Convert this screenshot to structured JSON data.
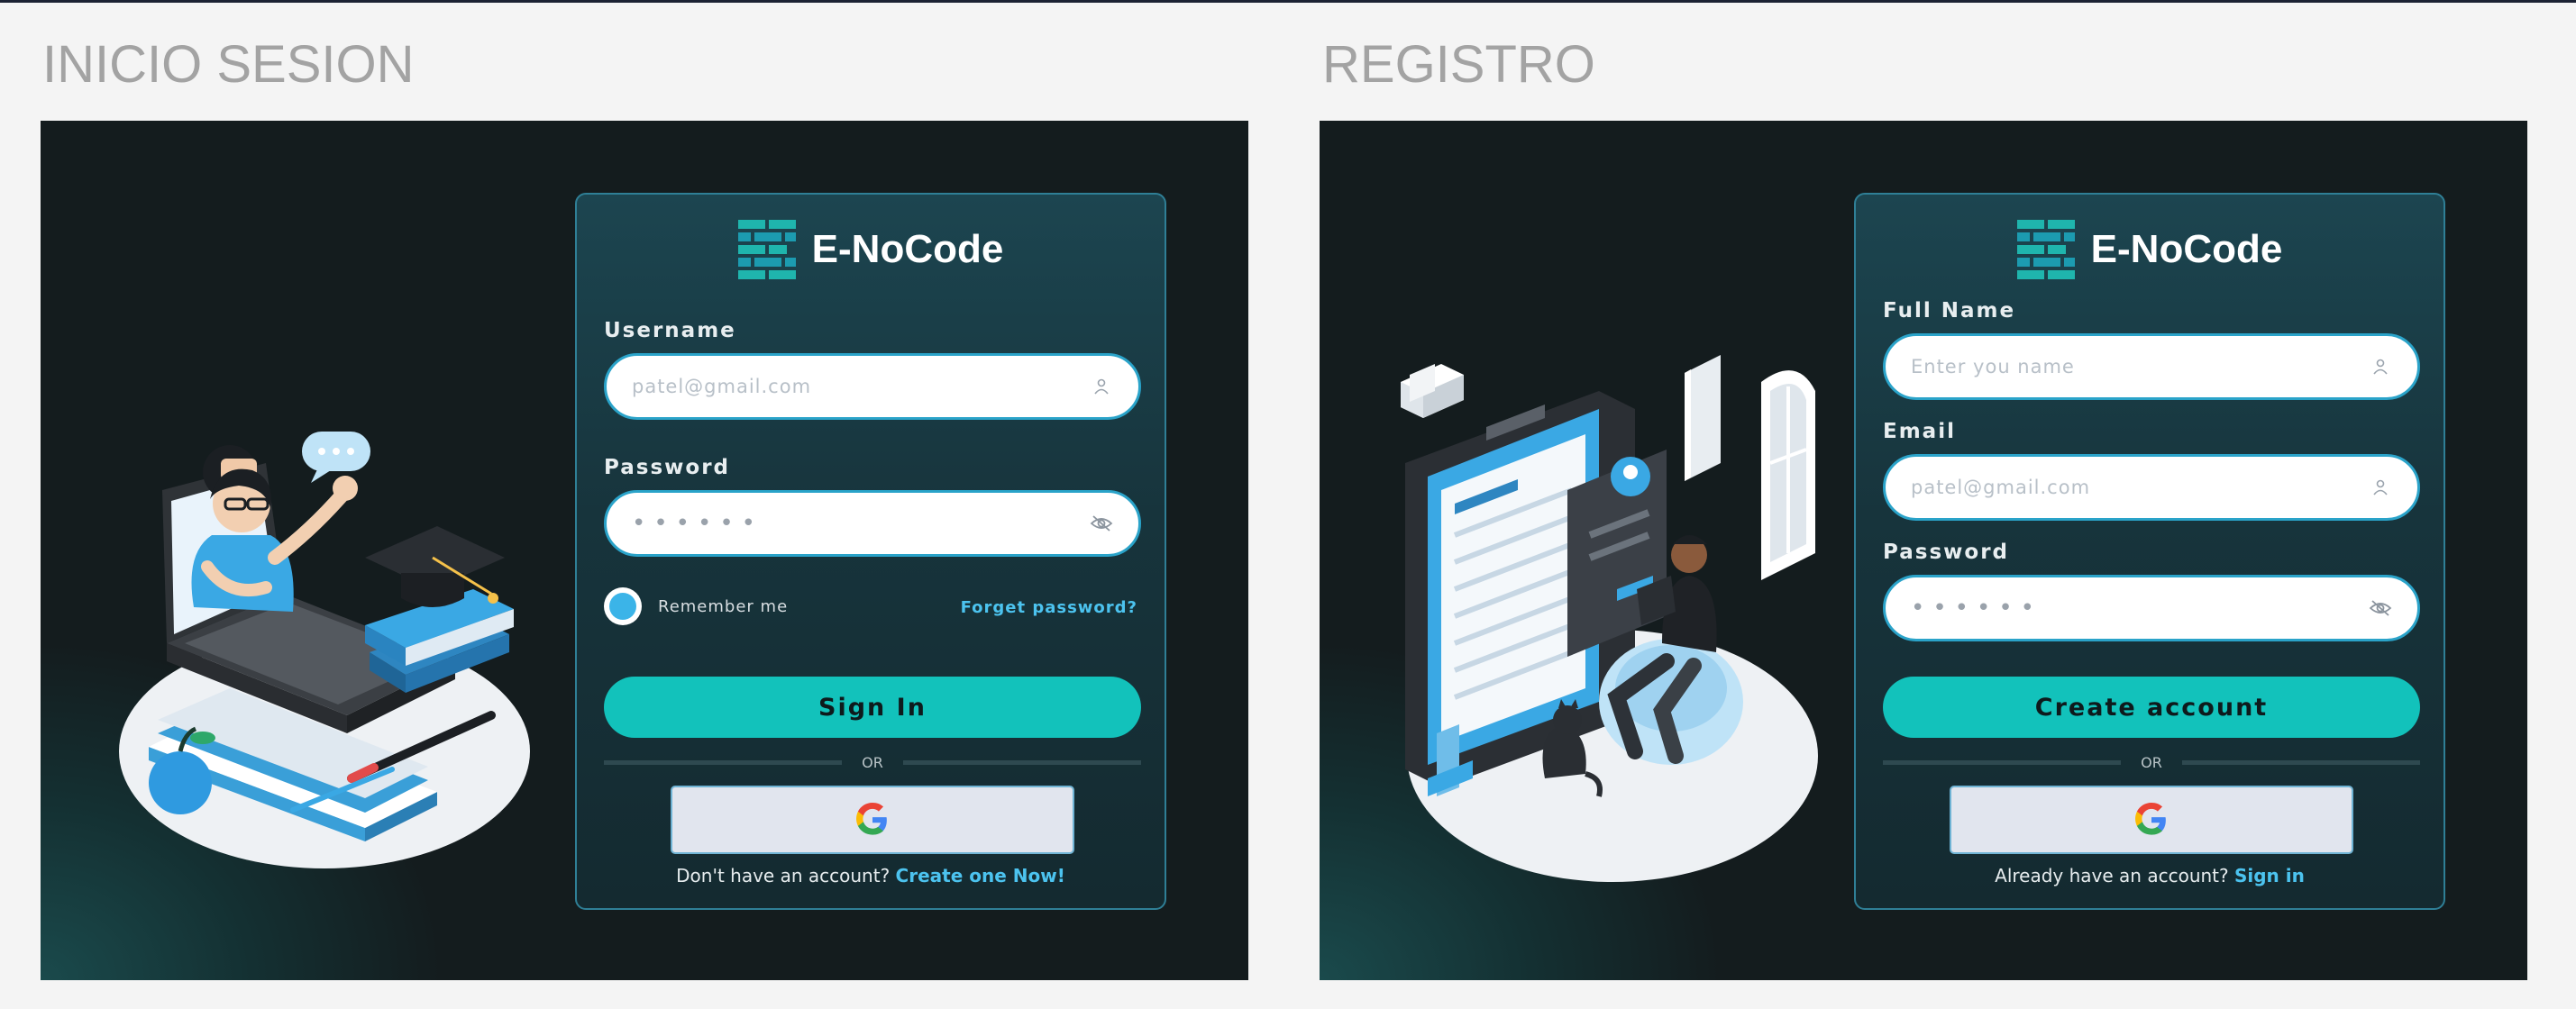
{
  "login": {
    "section_title": "INICIO SESION",
    "brand": "E-NoCode",
    "username_label": "Username",
    "username_placeholder": "patel@gmail.com",
    "password_label": "Password",
    "password_mask": "••••••",
    "remember_label": "Remember me",
    "forgot_label": "Forget password?",
    "submit_label": "Sign In",
    "divider_text": "OR",
    "footer_text": "Don't have an account?",
    "footer_link": "Create one Now!"
  },
  "register": {
    "section_title": "REGISTRO",
    "brand": "E-NoCode",
    "fullname_label": "Full Name",
    "fullname_placeholder": "Enter you name",
    "email_label": "Email",
    "email_placeholder": "patel@gmail.com",
    "password_label": "Password",
    "password_mask": "••••••",
    "submit_label": "Create account",
    "divider_text": "OR",
    "footer_text": "Already have an account?",
    "footer_link": "Sign in"
  },
  "icons": {
    "user_field": "user-icon",
    "password_toggle": "eye-off-icon",
    "google": "google-icon",
    "logo": "brick-logo-icon"
  },
  "colors": {
    "accent": "#12c2bb",
    "link": "#4cc3ef",
    "card_border": "#2f7f96",
    "panel_bg": "#141c1e"
  }
}
